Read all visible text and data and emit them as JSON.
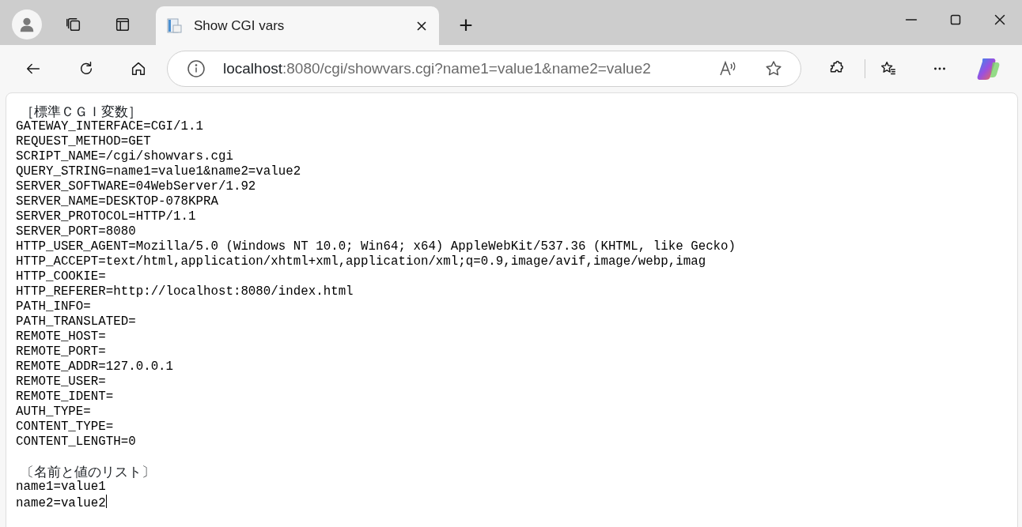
{
  "tab": {
    "title": "Show CGI vars",
    "selected": true
  },
  "new_tab": "+",
  "address": {
    "host": "localhost",
    "rest": ":8080/cgi/showvars.cgi?name1=value1&name2=value2"
  },
  "sections": [
    {
      "heading": "［標準ＣＧＩ変数］",
      "lines": [
        "GATEWAY_INTERFACE=CGI/1.1",
        "REQUEST_METHOD=GET",
        "SCRIPT_NAME=/cgi/showvars.cgi",
        "QUERY_STRING=name1=value1&name2=value2",
        "SERVER_SOFTWARE=04WebServer/1.92",
        "SERVER_NAME=DESKTOP-078KPRA",
        "SERVER_PROTOCOL=HTTP/1.1",
        "SERVER_PORT=8080",
        "HTTP_USER_AGENT=Mozilla/5.0 (Windows NT 10.0; Win64; x64) AppleWebKit/537.36 (KHTML, like Gecko)",
        "HTTP_ACCEPT=text/html,application/xhtml+xml,application/xml;q=0.9,image/avif,image/webp,imag",
        "HTTP_COOKIE=",
        "HTTP_REFERER=http://localhost:8080/index.html",
        "PATH_INFO=",
        "PATH_TRANSLATED=",
        "REMOTE_HOST=",
        "REMOTE_PORT=",
        "REMOTE_ADDR=127.0.0.1",
        "REMOTE_USER=",
        "REMOTE_IDENT=",
        "AUTH_TYPE=",
        "CONTENT_TYPE=",
        "CONTENT_LENGTH=0"
      ]
    },
    {
      "heading": "〔名前と値のリスト〕",
      "lines": [
        "name1=value1",
        "name2=value2"
      ]
    }
  ]
}
